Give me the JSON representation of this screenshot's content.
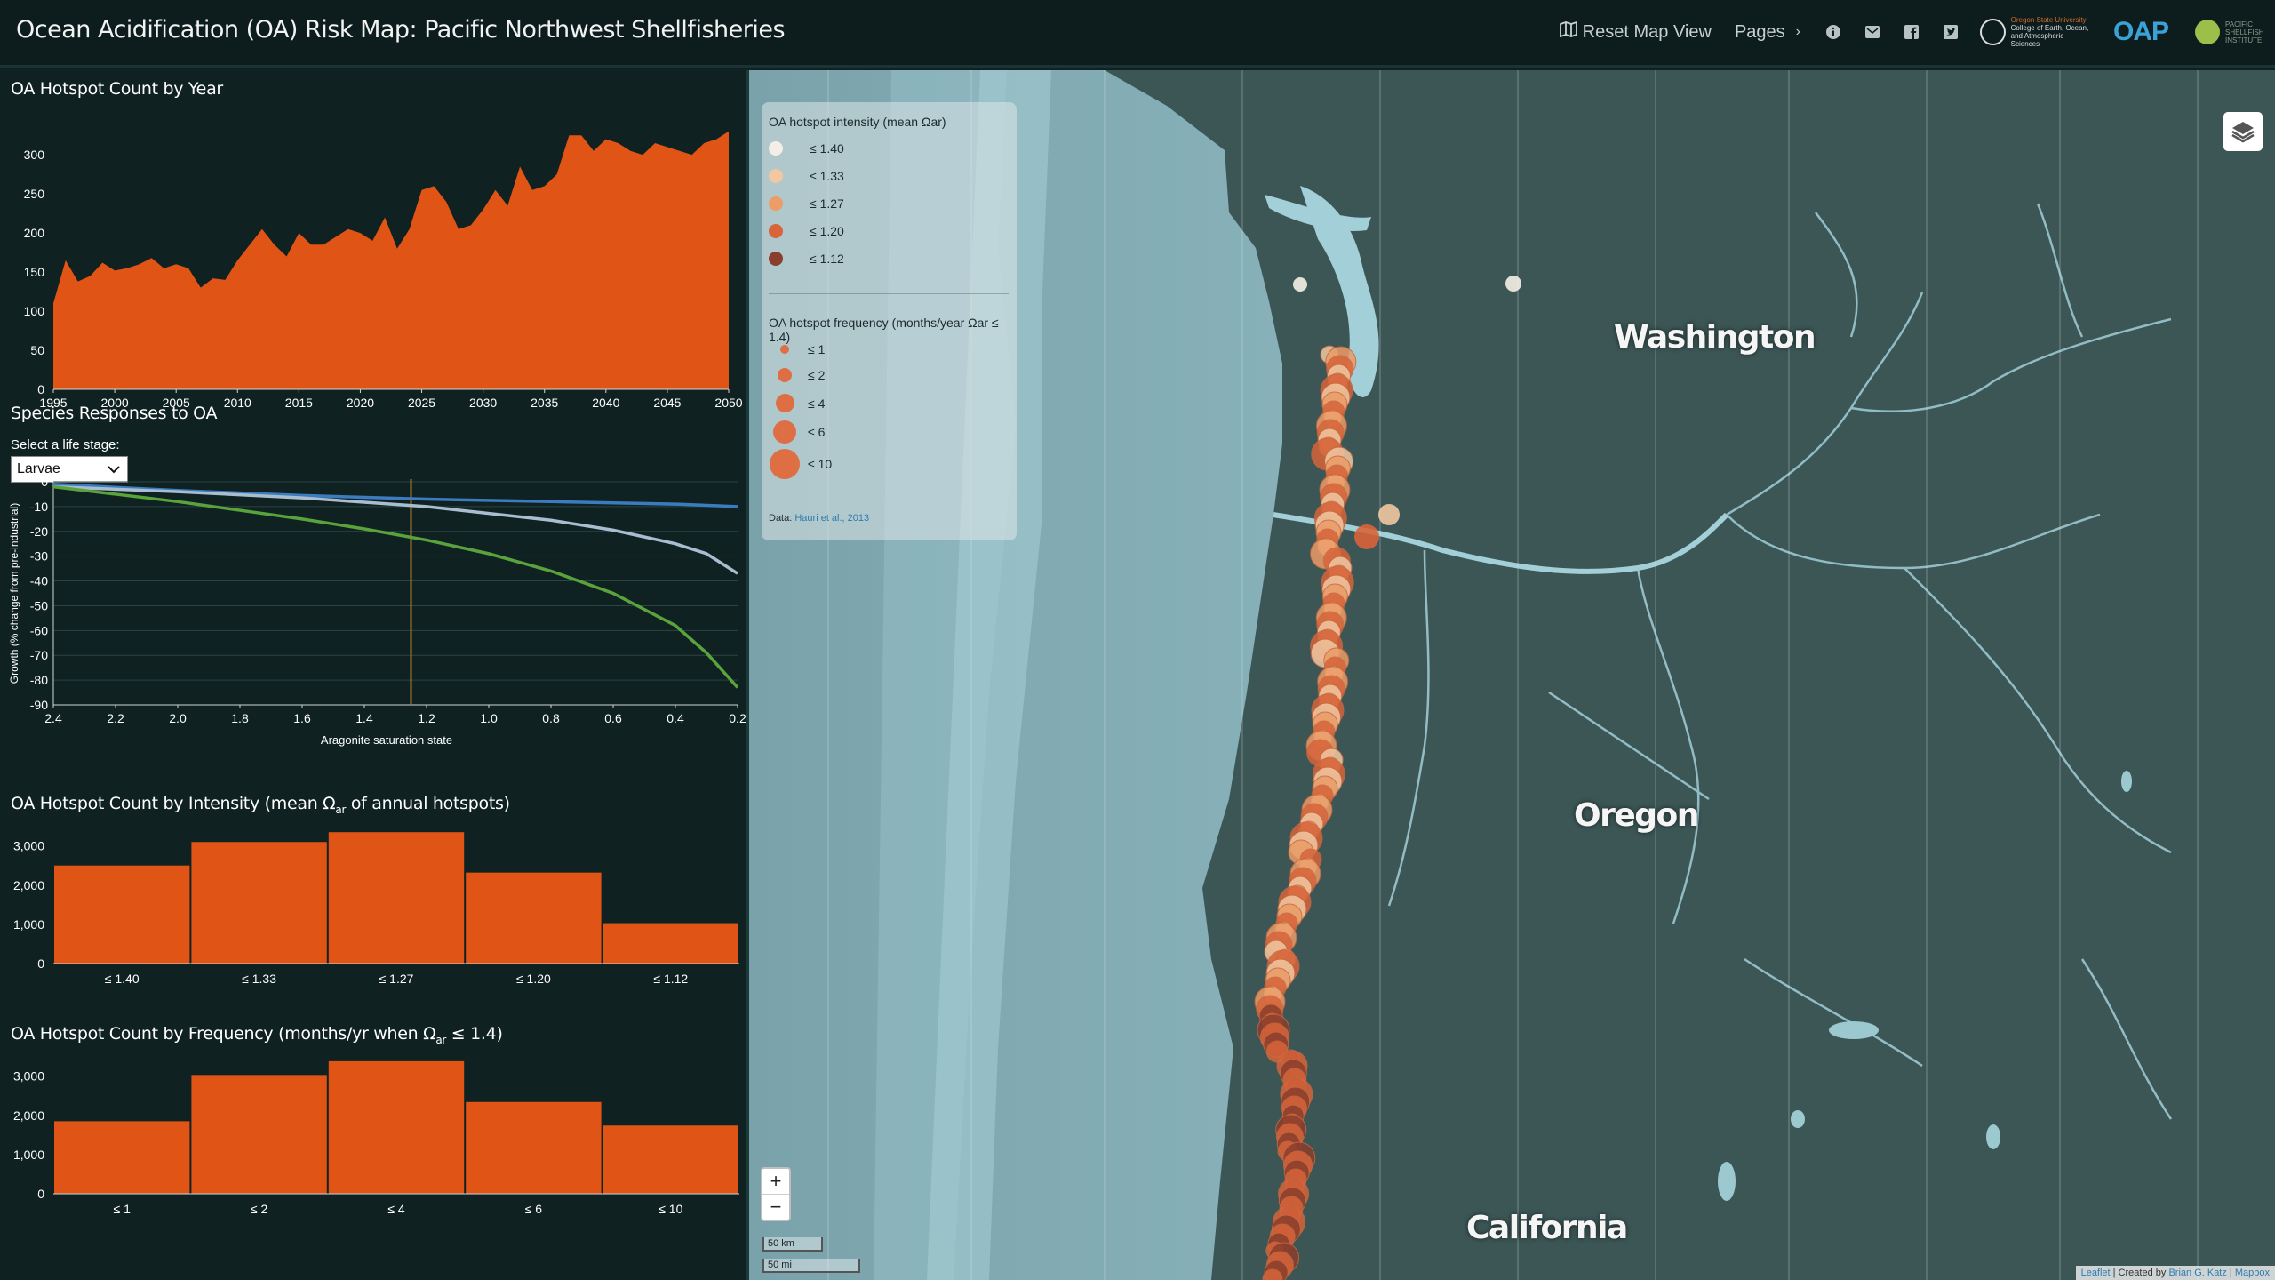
{
  "header": {
    "title": "Ocean Acidification (OA) Risk Map: Pacific Northwest Shellfisheries",
    "reset_label": "Reset Map View",
    "pages_label": "Pages",
    "osu_logo_lines": [
      "Oregon State University",
      "College of Earth, Ocean,",
      "and Atmospheric Sciences"
    ],
    "oap_logo": "OAP",
    "pse_logo_lines": [
      "PACIFIC",
      "SHELLFISH",
      "INSTITUTE"
    ]
  },
  "hotspot_year": {
    "title": "OA Hotspot Count by Year",
    "chart_data": {
      "type": "area",
      "x": [
        1995,
        1996,
        1997,
        1998,
        1999,
        2000,
        2001,
        2002,
        2003,
        2004,
        2005,
        2006,
        2007,
        2008,
        2009,
        2010,
        2011,
        2012,
        2013,
        2014,
        2015,
        2016,
        2017,
        2018,
        2019,
        2020,
        2021,
        2022,
        2023,
        2024,
        2025,
        2026,
        2027,
        2028,
        2029,
        2030,
        2031,
        2032,
        2033,
        2034,
        2035,
        2036,
        2037,
        2038,
        2039,
        2040,
        2041,
        2042,
        2043,
        2044,
        2045,
        2046,
        2047,
        2048,
        2049,
        2050
      ],
      "values": [
        110,
        165,
        138,
        145,
        162,
        152,
        155,
        160,
        168,
        155,
        160,
        155,
        130,
        142,
        140,
        165,
        185,
        205,
        185,
        170,
        200,
        185,
        185,
        195,
        205,
        200,
        190,
        220,
        180,
        205,
        255,
        260,
        240,
        205,
        210,
        230,
        255,
        235,
        285,
        255,
        260,
        275,
        325,
        325,
        305,
        320,
        315,
        305,
        300,
        315,
        310,
        305,
        300,
        315,
        320,
        330
      ],
      "xticks": [
        1995,
        2000,
        2005,
        2010,
        2015,
        2020,
        2025,
        2030,
        2035,
        2040,
        2045,
        2050
      ],
      "yticks": [
        0,
        50,
        100,
        150,
        200,
        250,
        300
      ],
      "ylim": [
        0,
        340
      ],
      "color": "#e05416"
    }
  },
  "species": {
    "title": "Species Responses to OA",
    "select_label": "Select a life stage:",
    "selected": "Larvae",
    "chart_data": {
      "type": "line",
      "xlabel": "Aragonite saturation state",
      "ylabel": "Growth (% change from pre-industrial)",
      "xlim": [
        2.4,
        0.2
      ],
      "ylim": [
        -90,
        0
      ],
      "xticks": [
        "2.4",
        "2.2",
        "2.0",
        "1.8",
        "1.6",
        "1.4",
        "1.2",
        "1.0",
        "0.8",
        "0.6",
        "0.4",
        "0.2"
      ],
      "yticks": [
        0,
        -10,
        -20,
        -30,
        -40,
        -50,
        -60,
        -70,
        -80,
        -90
      ],
      "threshold_x": 1.25,
      "series": [
        {
          "color": "#3b7bbf",
          "x": [
            2.4,
            2.0,
            1.6,
            1.2,
            0.8,
            0.4,
            0.2
          ],
          "values": [
            -1,
            -3.5,
            -5.5,
            -7,
            -8,
            -9,
            -10
          ]
        },
        {
          "color": "#a9bdd0",
          "x": [
            2.4,
            2.0,
            1.6,
            1.2,
            0.8,
            0.6,
            0.4,
            0.3,
            0.2
          ],
          "values": [
            -2,
            -4,
            -6.5,
            -10,
            -15.5,
            -19.5,
            -25,
            -29,
            -37
          ]
        },
        {
          "color": "#5aa33c",
          "x": [
            2.4,
            2.2,
            2.0,
            1.8,
            1.6,
            1.4,
            1.2,
            1.0,
            0.8,
            0.6,
            0.4,
            0.3,
            0.2
          ],
          "values": [
            -2,
            -5,
            -8,
            -11.5,
            -15,
            -19,
            -23.5,
            -29,
            -36,
            -45,
            -58,
            -69,
            -83
          ]
        }
      ]
    }
  },
  "intensity": {
    "title_prefix": "OA Hotspot Count by Intensity (mean Ω",
    "title_sub": "ar",
    "title_suffix": " of annual hotspots)",
    "chart_data": {
      "type": "bar",
      "categories": [
        "≤ 1.40",
        "≤ 1.33",
        "≤ 1.27",
        "≤ 1.20",
        "≤ 1.12"
      ],
      "values": [
        2500,
        3100,
        3350,
        2320,
        1030
      ],
      "yticks": [
        "0",
        "1,000",
        "2,000",
        "3,000"
      ],
      "ylim": [
        0,
        3400
      ],
      "color": "#e05416"
    }
  },
  "frequency": {
    "title_prefix": "OA Hotspot Count by Frequency (months/yr when Ω",
    "title_sub": "ar",
    "title_suffix": " ≤ 1.4)",
    "chart_data": {
      "type": "bar",
      "categories": [
        "≤ 1",
        "≤ 2",
        "≤ 4",
        "≤ 6",
        "≤ 10"
      ],
      "values": [
        1850,
        3030,
        3380,
        2340,
        1740
      ],
      "yticks": [
        "0",
        "1,000",
        "2,000",
        "3,000"
      ],
      "ylim": [
        0,
        3400
      ],
      "color": "#e05416"
    }
  },
  "legend": {
    "intensity_title": "OA hotspot intensity (mean Ωar)",
    "intensity_items": [
      {
        "label": "≤ 1.40",
        "color": "#f4efe6"
      },
      {
        "label": "≤ 1.33",
        "color": "#f1c8a1"
      },
      {
        "label": "≤ 1.27",
        "color": "#eb9c67"
      },
      {
        "label": "≤ 1.20",
        "color": "#d8643a"
      },
      {
        "label": "≤ 1.12",
        "color": "#8a3e2c"
      }
    ],
    "frequency_title": "OA hotspot frequency (months/year Ωar ≤ 1.4)",
    "frequency_items": [
      {
        "label": "≤ 1"
      },
      {
        "label": "≤ 2"
      },
      {
        "label": "≤ 4"
      },
      {
        "label": "≤ 6"
      },
      {
        "label": "≤ 10"
      }
    ],
    "source_prefix": "Data: ",
    "source_link": "Hauri et al., 2013"
  },
  "map": {
    "labels": [
      "Washington",
      "Oregon",
      "California"
    ],
    "zoom_in": "+",
    "zoom_out": "−",
    "scale_km": "50 km",
    "scale_mi": "50 mi",
    "attribution": {
      "leaflet": "Leaflet",
      "sep1": " | Created by ",
      "author": "Brian G. Katz",
      "sep2": " | ",
      "mapbox": "Mapbox"
    }
  }
}
